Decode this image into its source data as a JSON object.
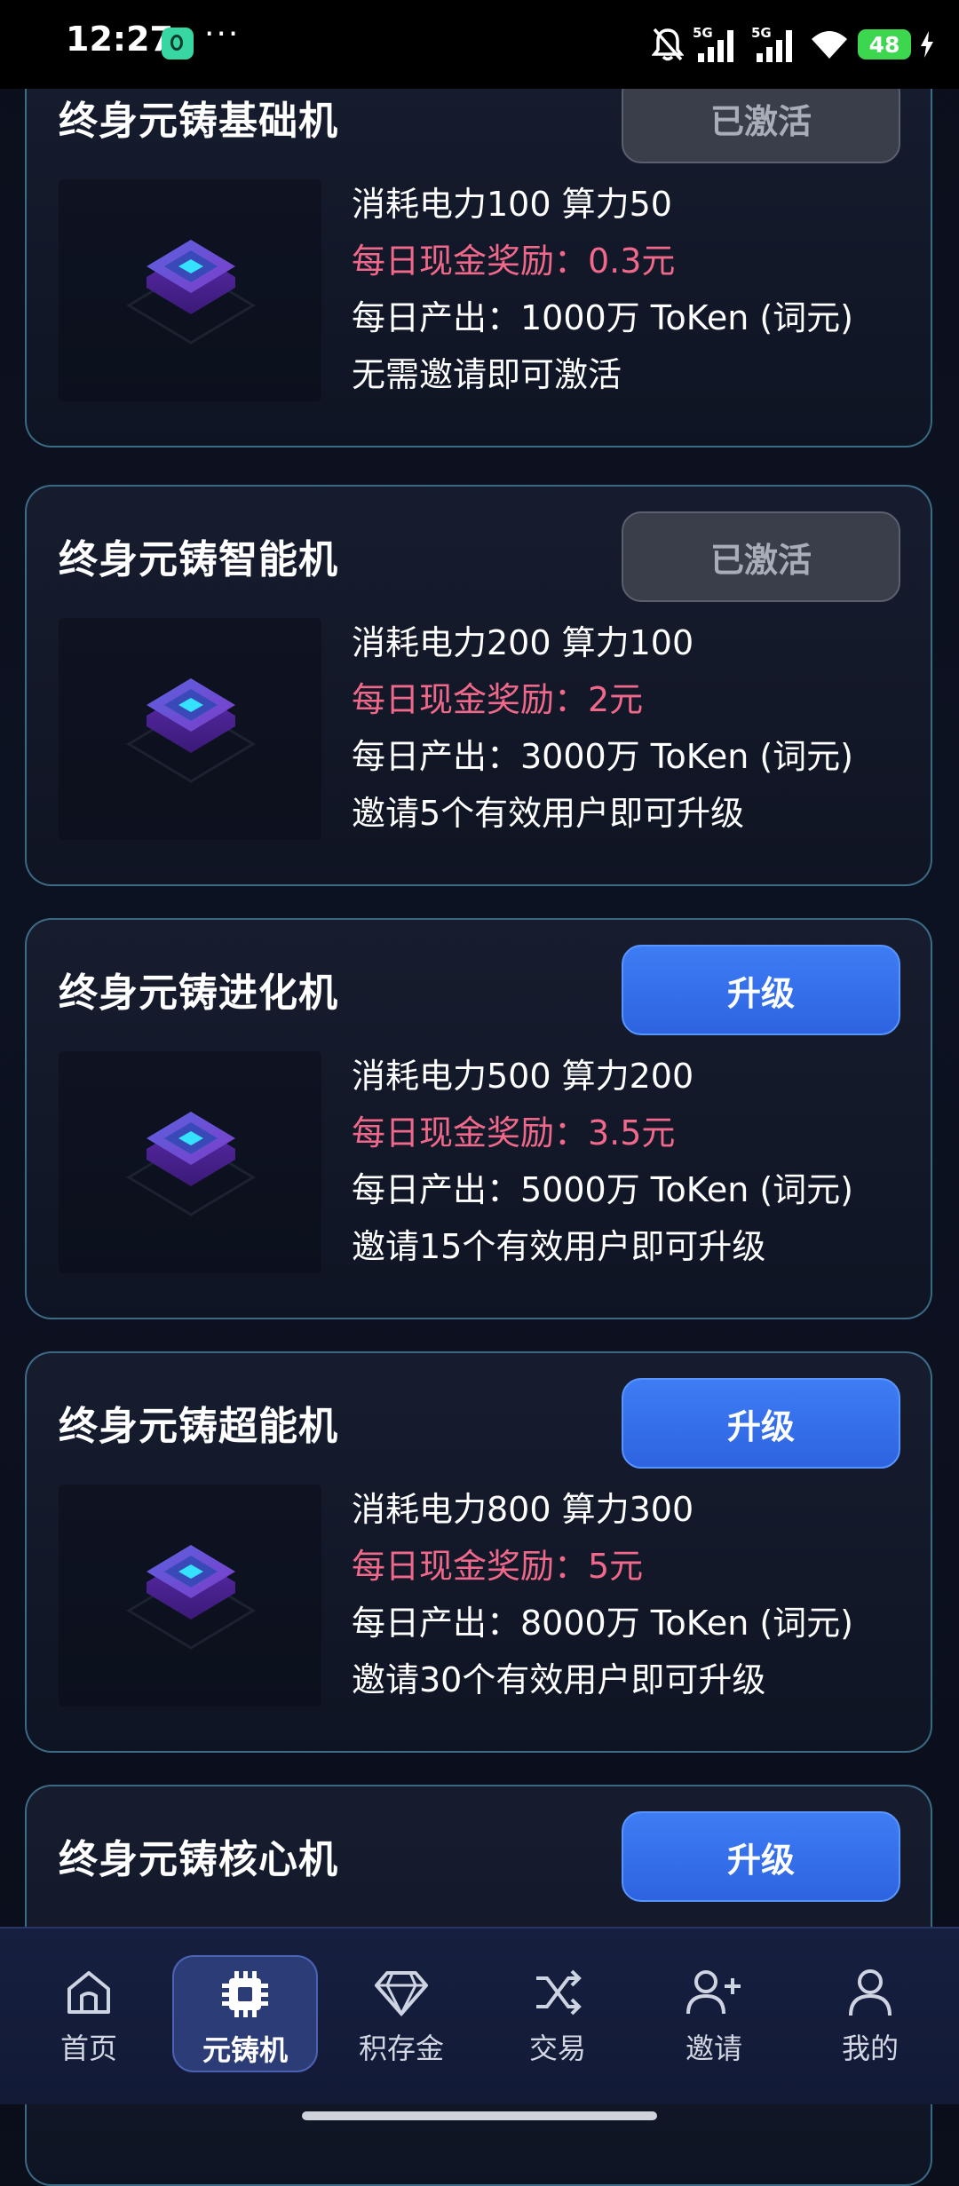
{
  "status_bar": {
    "time": "12:27",
    "dots": "···",
    "battery": "48",
    "signal1_label": "5G",
    "signal2_label": "5G"
  },
  "machines": [
    {
      "title": "终身元铸基础机",
      "button": "已激活",
      "button_state": "activated",
      "consumption": "消耗电力100 算力50",
      "reward": "每日现金奖励：0.3元",
      "output": "每日产出：1000万 ToKen (词元)",
      "requirement": "无需邀请即可激活"
    },
    {
      "title": "终身元铸智能机",
      "button": "已激活",
      "button_state": "activated",
      "consumption": "消耗电力200 算力100",
      "reward": "每日现金奖励：2元",
      "output": "每日产出：3000万 ToKen (词元)",
      "requirement": "邀请5个有效用户即可升级"
    },
    {
      "title": "终身元铸进化机",
      "button": "升级",
      "button_state": "upgrade",
      "consumption": "消耗电力500 算力200",
      "reward": "每日现金奖励：3.5元",
      "output": "每日产出：5000万 ToKen (词元)",
      "requirement": "邀请15个有效用户即可升级"
    },
    {
      "title": "终身元铸超能机",
      "button": "升级",
      "button_state": "upgrade",
      "consumption": "消耗电力800 算力300",
      "reward": "每日现金奖励：5元",
      "output": "每日产出：8000万 ToKen (词元)",
      "requirement": "邀请30个有效用户即可升级"
    },
    {
      "title": "终身元铸核心机",
      "button": "升级",
      "button_state": "upgrade"
    }
  ],
  "nav": {
    "items": [
      {
        "label": "首页",
        "icon": "home-icon"
      },
      {
        "label": "元铸机",
        "icon": "chip-icon",
        "active": true
      },
      {
        "label": "积存金",
        "icon": "diamond-icon"
      },
      {
        "label": "交易",
        "icon": "shuffle-icon"
      },
      {
        "label": "邀请",
        "icon": "add-user-icon"
      },
      {
        "label": "我的",
        "icon": "user-icon"
      }
    ]
  },
  "colors": {
    "reward_text": "#f0688a",
    "upgrade_button": "#3d7df4",
    "activated_button": "#3a3e4a",
    "card_border": "#5cb0d2",
    "nav_active": "#2c3c77"
  }
}
